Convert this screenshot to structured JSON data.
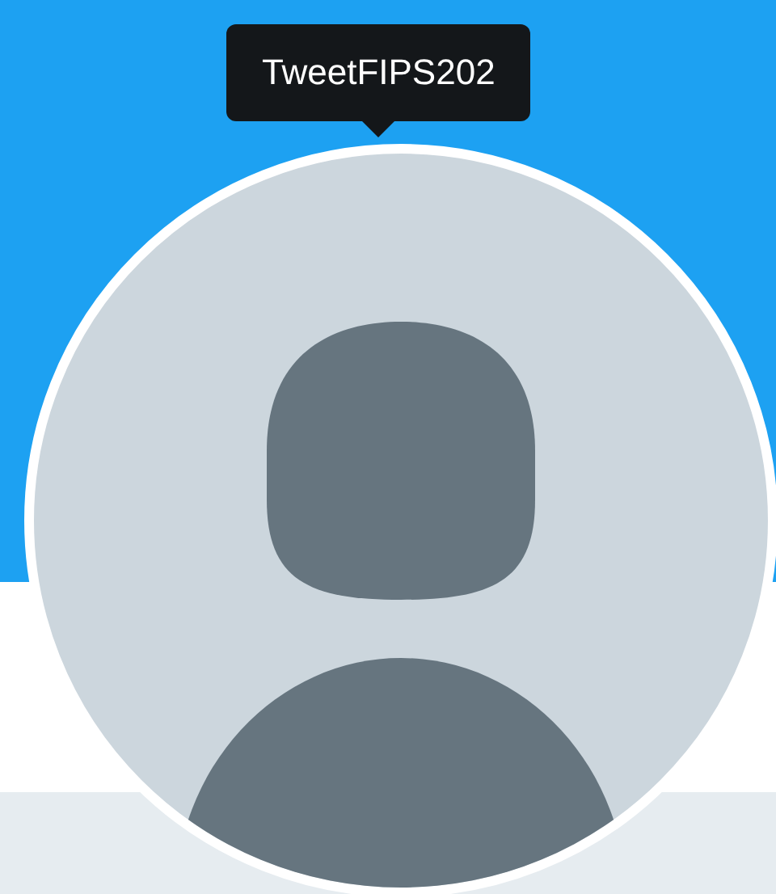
{
  "tooltip": {
    "text": "TweetFIPS202"
  }
}
